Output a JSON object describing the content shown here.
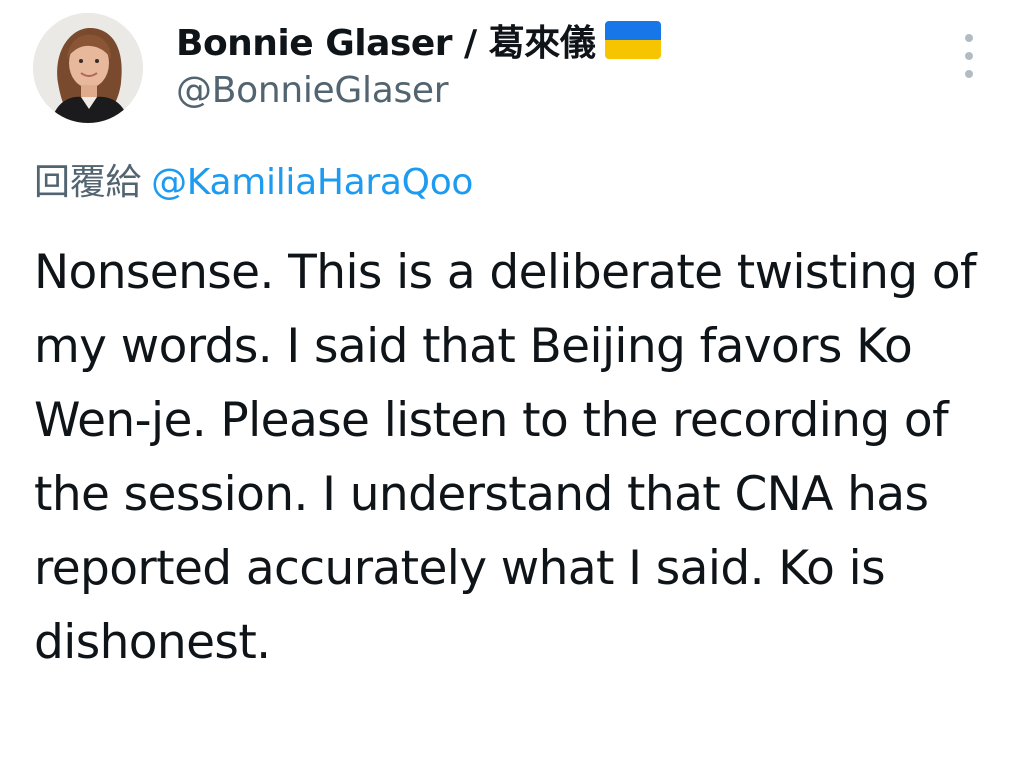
{
  "author": {
    "display_name": "Bonnie Glaser / 葛來儀",
    "handle": "@BonnieGlaser",
    "flag_icon": "ukraine-flag-icon",
    "flag_colors": {
      "top": "#1877e8",
      "bottom": "#f7c500"
    }
  },
  "reply": {
    "label": "回覆給",
    "mention": "@KamiliaHaraQoo"
  },
  "tweet": {
    "text": "Nonsense. This is a deliberate twisting of my words. I said that Beijing favors Ko Wen-je. Please listen to the recording of the session. I understand that CNA has reported accurately what I said. Ko is dishonest."
  },
  "more_menu_icon": "more-vertical-icon",
  "colors": {
    "text_primary": "#0f1419",
    "text_secondary": "#536471",
    "link": "#1d9bf0"
  }
}
